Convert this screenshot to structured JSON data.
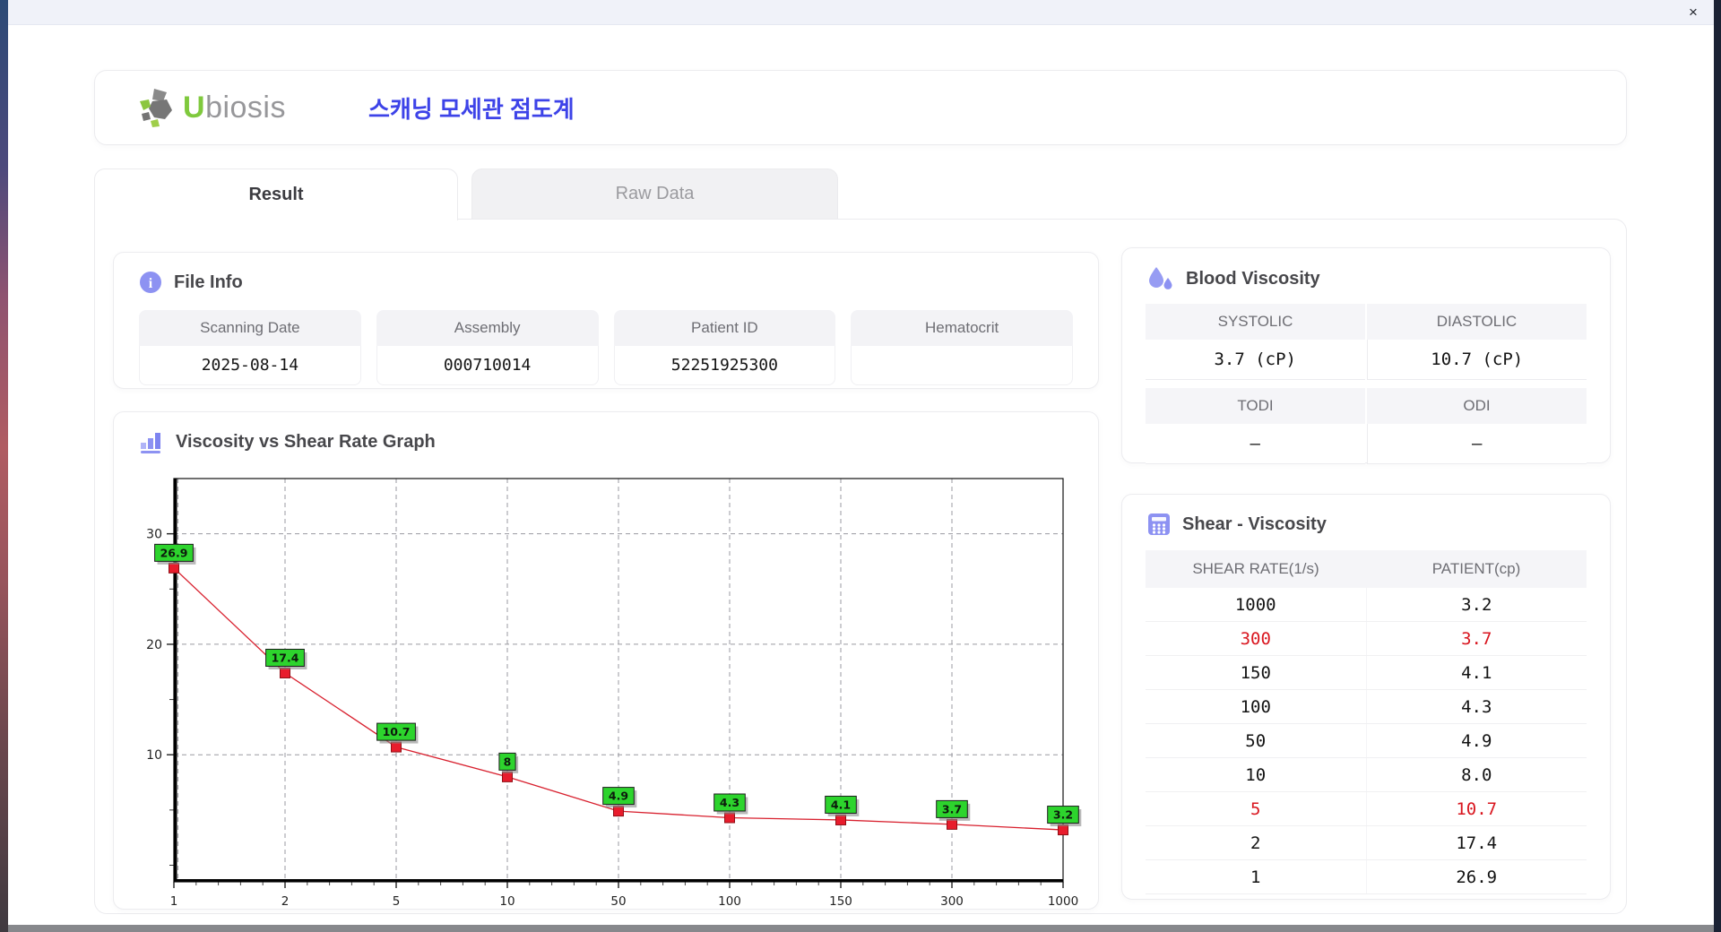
{
  "window": {
    "close_label": "×"
  },
  "header": {
    "brand_u": "U",
    "brand_rest": "biosis",
    "app_title": "스캐닝 모세관 점도계"
  },
  "tabs": [
    {
      "label": "Result",
      "active": true
    },
    {
      "label": "Raw Data",
      "active": false
    }
  ],
  "file_info": {
    "title": "File Info",
    "fields": [
      {
        "label": "Scanning Date",
        "value": "2025-08-14"
      },
      {
        "label": "Assembly",
        "value": "000710014"
      },
      {
        "label": "Patient ID",
        "value": "52251925300"
      },
      {
        "label": "Hematocrit",
        "value": ""
      }
    ]
  },
  "graph": {
    "title": "Viscosity vs Shear Rate Graph"
  },
  "blood_viscosity": {
    "title": "Blood Viscosity",
    "rows": [
      {
        "type": "header",
        "cells": [
          "SYSTOLIC",
          "DIASTOLIC"
        ]
      },
      {
        "type": "value",
        "cells": [
          "3.7 (cP)",
          "10.7 (cP)"
        ]
      },
      {
        "type": "header",
        "cells": [
          "TODI",
          "ODI"
        ]
      },
      {
        "type": "value",
        "cells": [
          "–",
          "–"
        ]
      }
    ]
  },
  "shear_viscosity": {
    "title": "Shear - Viscosity",
    "columns": [
      "SHEAR RATE(1/s)",
      "PATIENT(cp)"
    ],
    "rows": [
      {
        "shear_rate": "1000",
        "patient": "3.2",
        "highlight": false
      },
      {
        "shear_rate": "300",
        "patient": "3.7",
        "highlight": true
      },
      {
        "shear_rate": "150",
        "patient": "4.1",
        "highlight": false
      },
      {
        "shear_rate": "100",
        "patient": "4.3",
        "highlight": false
      },
      {
        "shear_rate": "50",
        "patient": "4.9",
        "highlight": false
      },
      {
        "shear_rate": "10",
        "patient": "8.0",
        "highlight": false
      },
      {
        "shear_rate": "5",
        "patient": "10.7",
        "highlight": true
      },
      {
        "shear_rate": "2",
        "patient": "17.4",
        "highlight": false
      },
      {
        "shear_rate": "1",
        "patient": "26.9",
        "highlight": false
      }
    ]
  },
  "chart_data": {
    "type": "line",
    "title": "Viscosity vs Shear Rate Graph",
    "x": [
      1,
      2,
      5,
      10,
      50,
      100,
      150,
      300,
      1000
    ],
    "x_tick_labels": [
      "1",
      "2",
      "5",
      "10",
      "50",
      "100",
      "150",
      "300",
      "1000"
    ],
    "x_scale": "category-equal-spacing",
    "values": [
      26.9,
      17.4,
      10.7,
      8,
      4.9,
      4.3,
      4.1,
      3.7,
      3.2
    ],
    "point_labels": [
      "26.9",
      "17.4",
      "10.7",
      "8",
      "4.9",
      "4.3",
      "4.1",
      "3.7",
      "3.2"
    ],
    "xlabel": "",
    "ylabel": "",
    "y_ticks": [
      10,
      20,
      30
    ],
    "y_minor_ticks": [
      0,
      5,
      15,
      25
    ],
    "ylim": [
      -1.5,
      35
    ],
    "grid": true,
    "legend": false,
    "line_color": "#d8202e",
    "marker": "square",
    "marker_color": "#e81c2c",
    "label_box_color": "#2dd42d"
  },
  "colors": {
    "accent_title": "#3d43e8",
    "icon_purple": "#8d92f2",
    "brand_green": "#7fc93d",
    "highlight_red": "#d9161f",
    "label_green": "#2dd42d",
    "series_red": "#d8202e"
  }
}
